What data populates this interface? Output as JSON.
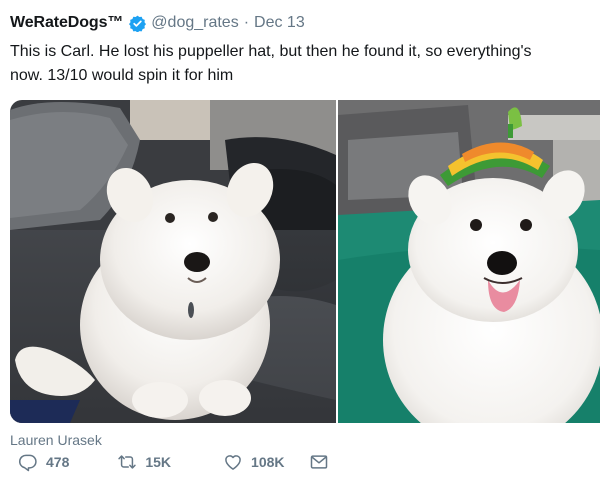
{
  "tweet": {
    "author_name": "WeRateDogs™",
    "handle": "@dog_rates",
    "separator": "·",
    "date": "Dec 13",
    "text_line1": "This is Carl. He lost his puppeller hat, but then he found it, so everything's",
    "text_line2": "now. 13/10 would spin it for him"
  },
  "media": {
    "photo_credit": "Lauren Urasek"
  },
  "actions": {
    "reply_count": "478",
    "retweet_count": "15K",
    "like_count": "108K"
  },
  "icons": [
    "verified-badge-icon",
    "reply-icon",
    "retweet-icon",
    "like-icon",
    "direct-message-icon"
  ],
  "colors": {
    "verified": "#1da1f2",
    "secondary_text": "#657786",
    "primary_text": "#14171a"
  }
}
